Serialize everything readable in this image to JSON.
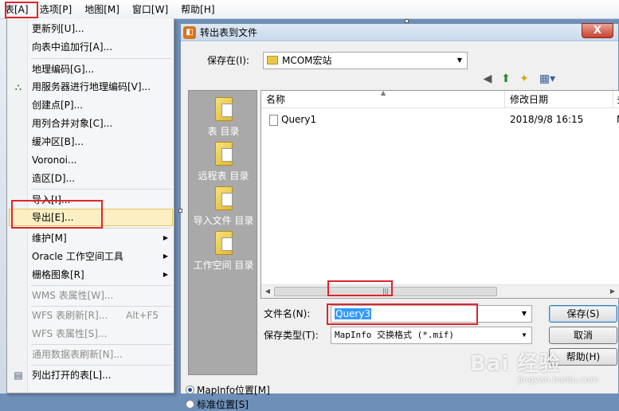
{
  "menubar": {
    "items": [
      "表[A]",
      "选项[P]",
      "地图[M]",
      "窗口[W]",
      "帮助[H]"
    ]
  },
  "table_menu": {
    "items": [
      {
        "label": "更新列[U]..."
      },
      {
        "label": "向表中追加行[A]..."
      },
      {
        "label": "地理编码[G]..."
      },
      {
        "label": "用服务器进行地理编码[V]..."
      },
      {
        "label": "创建点[P]..."
      },
      {
        "label": "用列合并对象[C]..."
      },
      {
        "label": "缓冲区[B]..."
      },
      {
        "label": "Voronoi..."
      },
      {
        "label": "造区[D]..."
      },
      {
        "label": "导入[I]..."
      },
      {
        "label": "导出[E]..."
      },
      {
        "label": "维护[M]"
      },
      {
        "label": "Oracle 工作空间工具"
      },
      {
        "label": "栅格图象[R]"
      },
      {
        "label": "WMS 表属性[W]..."
      },
      {
        "label": "WFS 表刷新[R]...",
        "shortcut": "Alt+F5"
      },
      {
        "label": "WFS 表属性[S]..."
      },
      {
        "label": "通用数据表刷新[N]..."
      },
      {
        "label": "列出打开的表[L]..."
      }
    ]
  },
  "dialog": {
    "title": "转出表到文件",
    "close_label": "X",
    "save_in_label": "保存在(I):",
    "save_in_value": "MCOM宏站",
    "places": [
      "表 目录",
      "远程表 目录",
      "导入文件 目录",
      "工作空间 目录"
    ],
    "columns": [
      "名称",
      "修改日期",
      "多"
    ],
    "files": [
      {
        "name": "Query1",
        "modified": "2018/9/8 16:15",
        "extra": "N"
      }
    ],
    "filename_label": "文件名(N):",
    "filename_value": "Query3",
    "filetype_label": "保存类型(T):",
    "filetype_value": "MapInfo 交换格式 (*.mif)",
    "save_button": "保存(S)",
    "cancel_button": "取消",
    "help_button": "帮助(H)",
    "radio_mapinfo": "MapInfo位置[M]",
    "radio_standard": "标准位置[S]"
  },
  "watermark": {
    "brand": "Bai 经验",
    "url": "jingyan.baidu.com"
  }
}
